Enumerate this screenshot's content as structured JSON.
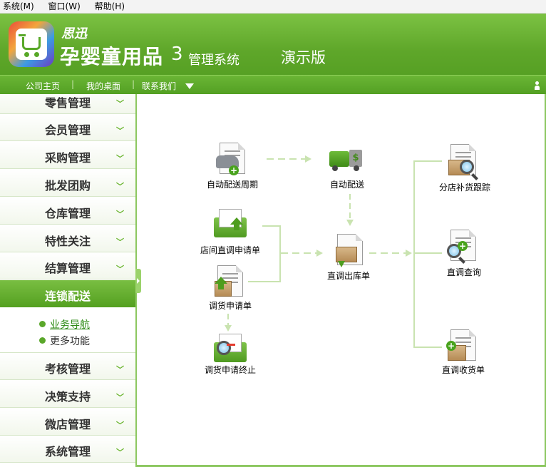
{
  "menubar": {
    "items": [
      "系统(M)",
      "窗口(W)",
      "帮助(H)"
    ]
  },
  "header": {
    "brand_small": "思迅",
    "brand_main": "孕婴童用品",
    "brand_num": "3",
    "brand_sub": "管理系统",
    "brand_demo": "演示版"
  },
  "navbar": {
    "items": [
      "公司主页",
      "我的桌面",
      "联系我们"
    ],
    "separator": "|"
  },
  "sidebar": {
    "items": [
      {
        "label": "零售管理",
        "active": false
      },
      {
        "label": "会员管理",
        "active": false
      },
      {
        "label": "采购管理",
        "active": false
      },
      {
        "label": "批发团购",
        "active": false
      },
      {
        "label": "仓库管理",
        "active": false
      },
      {
        "label": "特性关注",
        "active": false
      },
      {
        "label": "结算管理",
        "active": false
      },
      {
        "label": "连锁配送",
        "active": true
      },
      {
        "label": "考核管理",
        "active": false
      },
      {
        "label": "决策支持",
        "active": false
      },
      {
        "label": "微店管理",
        "active": false
      },
      {
        "label": "系统管理",
        "active": false
      }
    ],
    "chevron": "﹀",
    "subitems": [
      {
        "label": "业务导航",
        "link": true
      },
      {
        "label": "更多功能",
        "link": false
      }
    ]
  },
  "workflow": {
    "auto_cycle": "自动配送周期",
    "auto_delivery": "自动配送",
    "branch_track": "分店补货跟踪",
    "store_transfer_request": "店间直调申请单",
    "transfer_out": "直调出库单",
    "transfer_query": "直调查询",
    "goods_request": "调货申请单",
    "goods_request_stop": "调货申请终止",
    "transfer_receive": "直调收货单"
  },
  "colors": {
    "accent": "#5fa72a",
    "flow_line": "#c9e3b0"
  }
}
